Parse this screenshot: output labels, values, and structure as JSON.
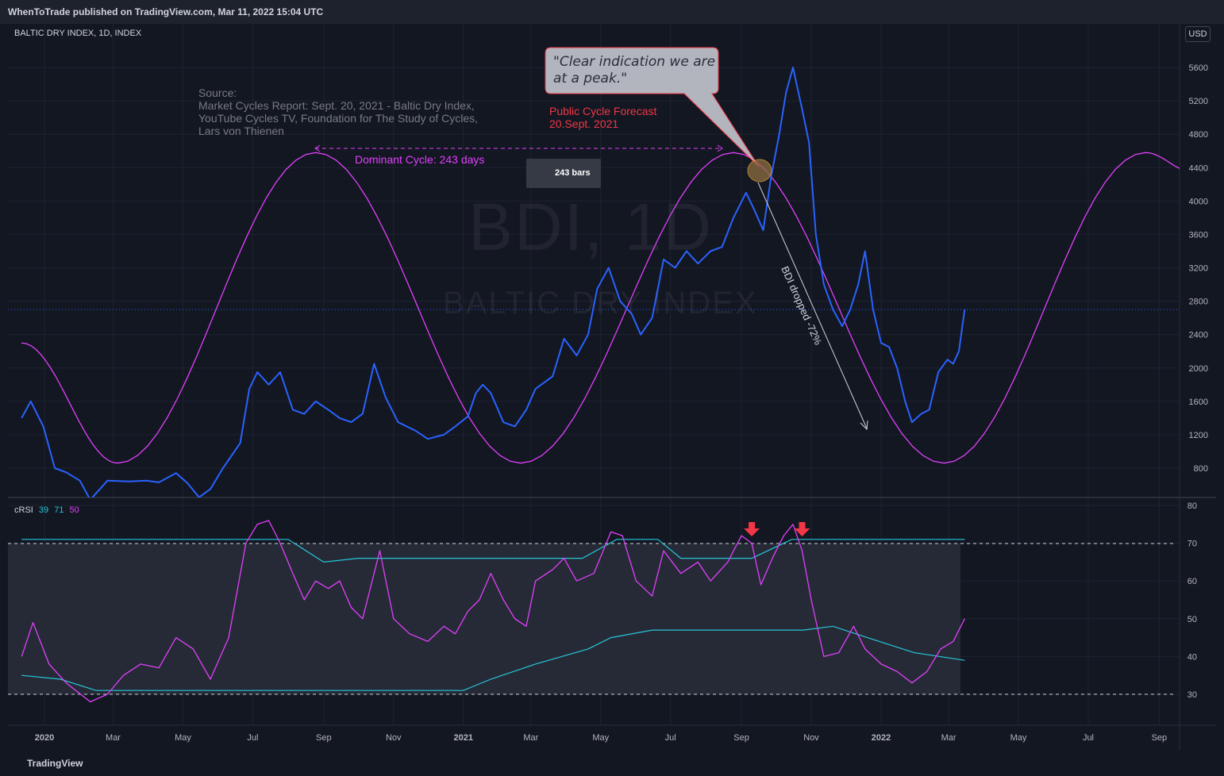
{
  "header": {
    "publisher": "WhenToTrade published on TradingView.com, Mar 11, 2022 15:04 UTC"
  },
  "symbol": {
    "title": "BALTIC DRY INDEX, 1D, INDEX",
    "currency": "USD",
    "watermark_main": "BDI, 1D",
    "watermark_sub": "BALTIC DRY INDEX"
  },
  "footer": {
    "brand": "TradingView"
  },
  "annotations": {
    "callout": "\"Clear indication we are at  a peak.\"",
    "source": "Source:\nMarket Cycles Report: Sept. 20, 2021 - Baltic Dry Index,\nYouTube Cycles TV, Foundation for The Study of Cycles,\nLars von Thienen",
    "forecast": "Public Cycle Forecast\n20.Sept. 2021",
    "cycle": "Dominant Cycle: 243 days",
    "bars": "243 bars",
    "drop": "BDI dropped -72%"
  },
  "colors": {
    "background": "#131722",
    "price": "#2962ff",
    "cycle": "#e040fb",
    "crsi": "#e040fb",
    "bands": "#26c6da",
    "forecast": "#f23645",
    "arrows": "#f23645"
  },
  "chart_data": [
    {
      "type": "line",
      "name_panel": "price",
      "ylim": [
        760,
        5900
      ],
      "y_ticks": [
        "5600",
        "5200",
        "4800",
        "4400",
        "4000",
        "3600",
        "3200",
        "2800",
        "2400",
        "2000",
        "1600",
        "1200",
        "800"
      ],
      "x_ticks": [
        "2020",
        "Mar",
        "May",
        "Jul",
        "Sep",
        "Nov",
        "2021",
        "Mar",
        "May",
        "Jul",
        "Sep",
        "Nov",
        "2022",
        "Mar",
        "May",
        "Jul",
        "Sep"
      ],
      "bold_x_ticks": [
        "2020",
        "2021",
        "2022"
      ],
      "series": [
        {
          "values": [
            [
              "2019-12-12",
              1400
            ],
            [
              "2019-12-20",
              1600
            ],
            [
              "2019-12-31",
              1300
            ],
            [
              "2020-01-10",
              800
            ],
            [
              "2020-01-20",
              750
            ],
            [
              "2020-02-01",
              650
            ],
            [
              "2020-02-10",
              420
            ],
            [
              "2020-02-25",
              650
            ],
            [
              "2020-03-15",
              640
            ],
            [
              "2020-03-30",
              650
            ],
            [
              "2020-04-10",
              630
            ],
            [
              "2020-04-25",
              740
            ],
            [
              "2020-05-05",
              620
            ],
            [
              "2020-05-15",
              450
            ],
            [
              "2020-05-25",
              550
            ],
            [
              "2020-06-05",
              800
            ],
            [
              "2020-06-20",
              1100
            ],
            [
              "2020-06-28",
              1750
            ],
            [
              "2020-07-05",
              1950
            ],
            [
              "2020-07-15",
              1800
            ],
            [
              "2020-07-25",
              1950
            ],
            [
              "2020-08-05",
              1500
            ],
            [
              "2020-08-15",
              1450
            ],
            [
              "2020-08-25",
              1600
            ],
            [
              "2020-09-05",
              1500
            ],
            [
              "2020-09-15",
              1400
            ],
            [
              "2020-09-25",
              1350
            ],
            [
              "2020-10-05",
              1450
            ],
            [
              "2020-10-15",
              2050
            ],
            [
              "2020-10-25",
              1650
            ],
            [
              "2020-11-05",
              1350
            ],
            [
              "2020-11-20",
              1250
            ],
            [
              "2020-12-01",
              1150
            ],
            [
              "2020-12-15",
              1200
            ],
            [
              "2020-12-25",
              1300
            ],
            [
              "2021-01-05",
              1420
            ],
            [
              "2021-01-12",
              1700
            ],
            [
              "2021-01-18",
              1800
            ],
            [
              "2021-01-25",
              1700
            ],
            [
              "2021-02-05",
              1350
            ],
            [
              "2021-02-15",
              1300
            ],
            [
              "2021-02-25",
              1500
            ],
            [
              "2021-03-05",
              1750
            ],
            [
              "2021-03-20",
              1900
            ],
            [
              "2021-03-30",
              2350
            ],
            [
              "2021-04-10",
              2150
            ],
            [
              "2021-04-20",
              2400
            ],
            [
              "2021-04-28",
              2950
            ],
            [
              "2021-05-08",
              3200
            ],
            [
              "2021-05-18",
              2800
            ],
            [
              "2021-05-28",
              2650
            ],
            [
              "2021-06-05",
              2400
            ],
            [
              "2021-06-15",
              2600
            ],
            [
              "2021-06-25",
              3300
            ],
            [
              "2021-07-05",
              3200
            ],
            [
              "2021-07-15",
              3400
            ],
            [
              "2021-07-25",
              3250
            ],
            [
              "2021-08-05",
              3400
            ],
            [
              "2021-08-15",
              3450
            ],
            [
              "2021-08-25",
              3800
            ],
            [
              "2021-09-05",
              4100
            ],
            [
              "2021-09-12",
              3900
            ],
            [
              "2021-09-20",
              3650
            ],
            [
              "2021-09-27",
              4300
            ],
            [
              "2021-10-04",
              4800
            ],
            [
              "2021-10-10",
              5300
            ],
            [
              "2021-10-16",
              5600
            ],
            [
              "2021-10-24",
              5100
            ],
            [
              "2021-10-30",
              4700
            ],
            [
              "2021-11-05",
              3600
            ],
            [
              "2021-11-12",
              3000
            ],
            [
              "2021-11-20",
              2700
            ],
            [
              "2021-11-28",
              2500
            ],
            [
              "2021-12-05",
              2700
            ],
            [
              "2021-12-12",
              3000
            ],
            [
              "2021-12-18",
              3400
            ],
            [
              "2021-12-25",
              2700
            ],
            [
              "2022-01-01",
              2300
            ],
            [
              "2022-01-08",
              2250
            ],
            [
              "2022-01-15",
              2000
            ],
            [
              "2022-01-22",
              1600
            ],
            [
              "2022-01-28",
              1350
            ],
            [
              "2022-02-05",
              1450
            ],
            [
              "2022-02-12",
              1500
            ],
            [
              "2022-02-20",
              1950
            ],
            [
              "2022-02-28",
              2100
            ],
            [
              "2022-03-05",
              2050
            ],
            [
              "2022-03-10",
              2200
            ],
            [
              "2022-03-15",
              2700
            ]
          ]
        }
      ],
      "cycle_series": {
        "values": [
          [
            "2019-12-12",
            2300
          ],
          [
            "2020-03-05",
            860
          ],
          [
            "2020-08-25",
            4580
          ],
          [
            "2021-02-20",
            860
          ],
          [
            "2021-08-25",
            4580
          ],
          [
            "2022-02-25",
            860
          ],
          [
            "2022-08-20",
            4580
          ],
          [
            "2022-09-30",
            4350
          ]
        ]
      },
      "last_price_line": 2700
    },
    {
      "type": "line",
      "name_panel": "crsi",
      "legend": [
        "cRSI",
        "39",
        "71",
        "50"
      ],
      "ylim": [
        24,
        83
      ],
      "y_ticks": [
        "80",
        "70",
        "60",
        "50",
        "40",
        "30"
      ],
      "levels": [
        70,
        30
      ],
      "series": [
        {
          "values": [
            [
              "2019-12-12",
              40
            ],
            [
              "2019-12-22",
              49
            ],
            [
              "2020-01-05",
              38
            ],
            [
              "2020-01-20",
              33
            ],
            [
              "2020-02-10",
              28
            ],
            [
              "2020-02-25",
              30
            ],
            [
              "2020-03-10",
              35
            ],
            [
              "2020-03-25",
              38
            ],
            [
              "2020-04-10",
              37
            ],
            [
              "2020-04-25",
              45
            ],
            [
              "2020-05-10",
              42
            ],
            [
              "2020-05-25",
              34
            ],
            [
              "2020-06-10",
              45
            ],
            [
              "2020-06-25",
              70
            ],
            [
              "2020-07-05",
              75
            ],
            [
              "2020-07-15",
              76
            ],
            [
              "2020-07-25",
              70
            ],
            [
              "2020-08-05",
              62
            ],
            [
              "2020-08-15",
              55
            ],
            [
              "2020-08-25",
              60
            ],
            [
              "2020-09-05",
              58
            ],
            [
              "2020-09-15",
              60
            ],
            [
              "2020-09-25",
              53
            ],
            [
              "2020-10-05",
              50
            ],
            [
              "2020-10-20",
              68
            ],
            [
              "2020-11-01",
              50
            ],
            [
              "2020-11-15",
              46
            ],
            [
              "2020-12-01",
              44
            ],
            [
              "2020-12-15",
              48
            ],
            [
              "2020-12-25",
              46
            ],
            [
              "2021-01-05",
              52
            ],
            [
              "2021-01-15",
              55
            ],
            [
              "2021-01-25",
              62
            ],
            [
              "2021-02-05",
              55
            ],
            [
              "2021-02-15",
              50
            ],
            [
              "2021-02-25",
              48
            ],
            [
              "2021-03-05",
              60
            ],
            [
              "2021-03-20",
              63
            ],
            [
              "2021-03-30",
              66
            ],
            [
              "2021-04-10",
              60
            ],
            [
              "2021-04-25",
              62
            ],
            [
              "2021-05-10",
              73
            ],
            [
              "2021-05-20",
              72
            ],
            [
              "2021-06-01",
              60
            ],
            [
              "2021-06-15",
              56
            ],
            [
              "2021-06-25",
              68
            ],
            [
              "2021-07-10",
              62
            ],
            [
              "2021-07-25",
              65
            ],
            [
              "2021-08-05",
              60
            ],
            [
              "2021-08-20",
              65
            ],
            [
              "2021-09-01",
              72
            ],
            [
              "2021-09-10",
              70
            ],
            [
              "2021-09-18",
              59
            ],
            [
              "2021-09-28",
              66
            ],
            [
              "2021-10-08",
              72
            ],
            [
              "2021-10-16",
              75
            ],
            [
              "2021-10-24",
              68
            ],
            [
              "2021-11-01",
              55
            ],
            [
              "2021-11-12",
              40
            ],
            [
              "2021-11-25",
              41
            ],
            [
              "2021-12-08",
              48
            ],
            [
              "2021-12-18",
              42
            ],
            [
              "2022-01-01",
              38
            ],
            [
              "2022-01-15",
              36
            ],
            [
              "2022-01-28",
              33
            ],
            [
              "2022-02-10",
              36
            ],
            [
              "2022-02-22",
              42
            ],
            [
              "2022-03-05",
              44
            ],
            [
              "2022-03-15",
              50
            ]
          ]
        }
      ],
      "upper_band": {
        "values": [
          [
            "2019-12-12",
            71
          ],
          [
            "2020-08-01",
            71
          ],
          [
            "2020-09-01",
            65
          ],
          [
            "2020-10-01",
            66
          ],
          [
            "2021-04-15",
            66
          ],
          [
            "2021-05-15",
            71
          ],
          [
            "2021-06-20",
            71
          ],
          [
            "2021-07-10",
            66
          ],
          [
            "2021-09-10",
            66
          ],
          [
            "2021-10-15",
            71
          ],
          [
            "2022-03-15",
            71
          ]
        ]
      },
      "lower_band": {
        "values": [
          [
            "2019-12-12",
            35
          ],
          [
            "2020-01-15",
            34
          ],
          [
            "2020-02-15",
            31
          ],
          [
            "2021-01-01",
            31
          ],
          [
            "2021-01-25",
            34
          ],
          [
            "2021-03-05",
            38
          ],
          [
            "2021-04-20",
            42
          ],
          [
            "2021-05-10",
            45
          ],
          [
            "2021-06-15",
            47
          ],
          [
            "2021-10-25",
            47
          ],
          [
            "2021-11-20",
            48
          ],
          [
            "2021-12-20",
            45
          ],
          [
            "2022-01-30",
            41
          ],
          [
            "2022-03-15",
            39
          ]
        ]
      },
      "signal_arrows": [
        "2021-09-10",
        "2021-10-24"
      ]
    }
  ]
}
